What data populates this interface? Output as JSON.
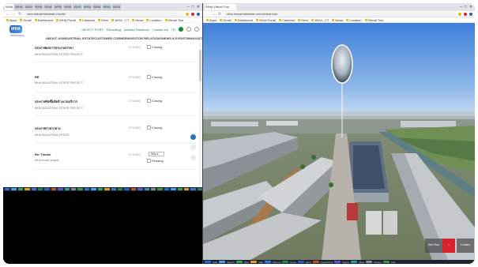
{
  "left_window": {
    "tabs": [
      "WHA",
      "WHA",
      "WHA",
      "WHA",
      "WHA",
      "WHA",
      "WHA",
      "WHA",
      "WHA",
      "WHA",
      "WHA",
      "WHA"
    ],
    "url": "wha-industrialestate.com/th",
    "bookmarks": [
      "Apps",
      "Gmail",
      "Dashboard",
      "WHA Portal",
      "Calendar",
      "Drive",
      "WHA - CT",
      "News",
      "Location",
      "Virtual Tour"
    ],
    "header": {
      "logo_text": "WHA",
      "logo_sub": "INDUSTRIAL",
      "top_links": [
        "SELECT PORT",
        "Recruiting",
        "Investor Relations",
        "Contact Us",
        "TH"
      ],
      "nav": [
        "ABOUT US",
        "INDUSTRIAL ESTATE",
        "CUSTOMER CORNER",
        "INVESTOR RELATIONS",
        "NEWS & EVENTS",
        "INNOVATION"
      ]
    },
    "rows": [
      {
        "title": "ประกาศผลการประกวดราคา",
        "sub": "WHA INDUSTRIAL ESTATE PROJECT",
        "date": "17/10/65",
        "status": "Closing"
      },
      {
        "title": "RE",
        "sub": "WHA INDUSTRIAL ESTATE PROJECT",
        "date": "17/10/65",
        "status": "Closing"
      },
      {
        "title": "ประกาศจัดซื้อจัดจ้างงานบริการ",
        "sub": "WHA INDUSTRIAL ESTATE PROJECT",
        "date": "17/10/65",
        "status": "Closing"
      },
      {
        "title": "ประกาศราคากลาง",
        "sub": "WHA INDUSTRIAL ESTATE",
        "date": "17/10/65",
        "status": "Closing"
      },
      {
        "title": "Re: Tender",
        "sub": "WHA tender project",
        "date": "17/10/65",
        "status": "Pending",
        "select": "Wks"
      }
    ]
  },
  "right_window": {
    "tabs": [
      "WHA Virtual Tour"
    ],
    "url": "wha-industrialestate.com/virtual-tour",
    "bookmarks": [
      "Apps",
      "Gmail",
      "Dashboard",
      "WHA Portal",
      "Calendar",
      "Drive",
      "WHA - CT",
      "News",
      "Location",
      "Virtual Tour"
    ],
    "corner_buttons": [
      "Site Plan",
      "",
      "Contact"
    ]
  },
  "taskbar_right": [
    "Start",
    "Search",
    "Files",
    "Mail",
    "Chrome",
    "Excel",
    "Word",
    "PowerPoint",
    "Teams",
    "Maps",
    "Photos",
    "Calc"
  ],
  "colors": {
    "brand_blue": "#2a5fb0",
    "accent_green": "#1a8a3a",
    "red": "#d6222a"
  }
}
